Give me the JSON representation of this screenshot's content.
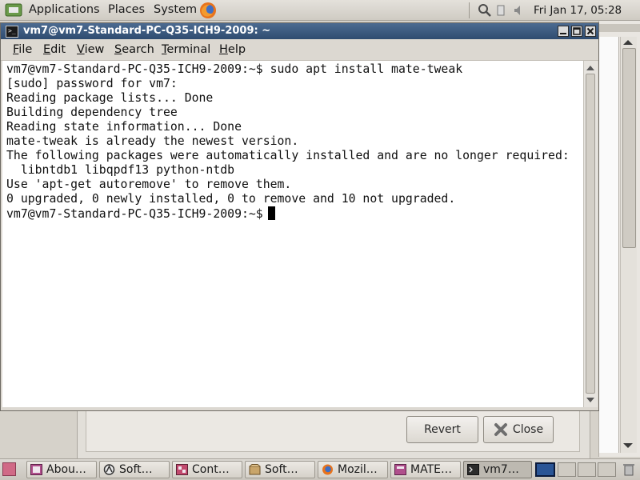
{
  "top_panel": {
    "menus": [
      "Applications",
      "Places",
      "System"
    ],
    "clock": "Fri Jan 17, 05:28"
  },
  "terminal": {
    "title": "vm7@vm7-Standard-PC-Q35-ICH9-2009: ~",
    "menu": [
      {
        "underline": "F",
        "rest": "ile"
      },
      {
        "underline": "E",
        "rest": "dit"
      },
      {
        "underline": "V",
        "rest": "iew"
      },
      {
        "underline": "S",
        "rest": "earch"
      },
      {
        "underline": "T",
        "rest": "erminal"
      },
      {
        "underline": "H",
        "rest": "elp"
      }
    ],
    "lines": [
      "vm7@vm7-Standard-PC-Q35-ICH9-2009:~$ sudo apt install mate-tweak",
      "[sudo] password for vm7:",
      "Reading package lists... Done",
      "Building dependency tree",
      "Reading state information... Done",
      "mate-tweak is already the newest version.",
      "The following packages were automatically installed and are no longer required:",
      "  libntdb1 libqpdf13 python-ntdb",
      "Use 'apt-get autoremove' to remove them.",
      "0 upgraded, 0 newly installed, 0 to remove and 10 not upgraded."
    ],
    "prompt": "vm7@vm7-Standard-PC-Q35-ICH9-2009:~$"
  },
  "dialog": {
    "revert_label": "Revert",
    "close_label": "Close"
  },
  "taskbar": {
    "tasks": [
      {
        "label": "Abou…",
        "icon": "about-icon"
      },
      {
        "label": "Soft…",
        "icon": "software-icon"
      },
      {
        "label": "Cont…",
        "icon": "control-center-icon"
      },
      {
        "label": "Soft…",
        "icon": "package-icon"
      },
      {
        "label": "Mozil…",
        "icon": "firefox-icon"
      },
      {
        "label": "MATE…",
        "icon": "mate-tweak-icon"
      },
      {
        "label": "vm7…",
        "icon": "terminal-icon"
      }
    ]
  },
  "colors": {
    "titlebar": "#3d5b82",
    "active_workspace": "#2a5596"
  }
}
